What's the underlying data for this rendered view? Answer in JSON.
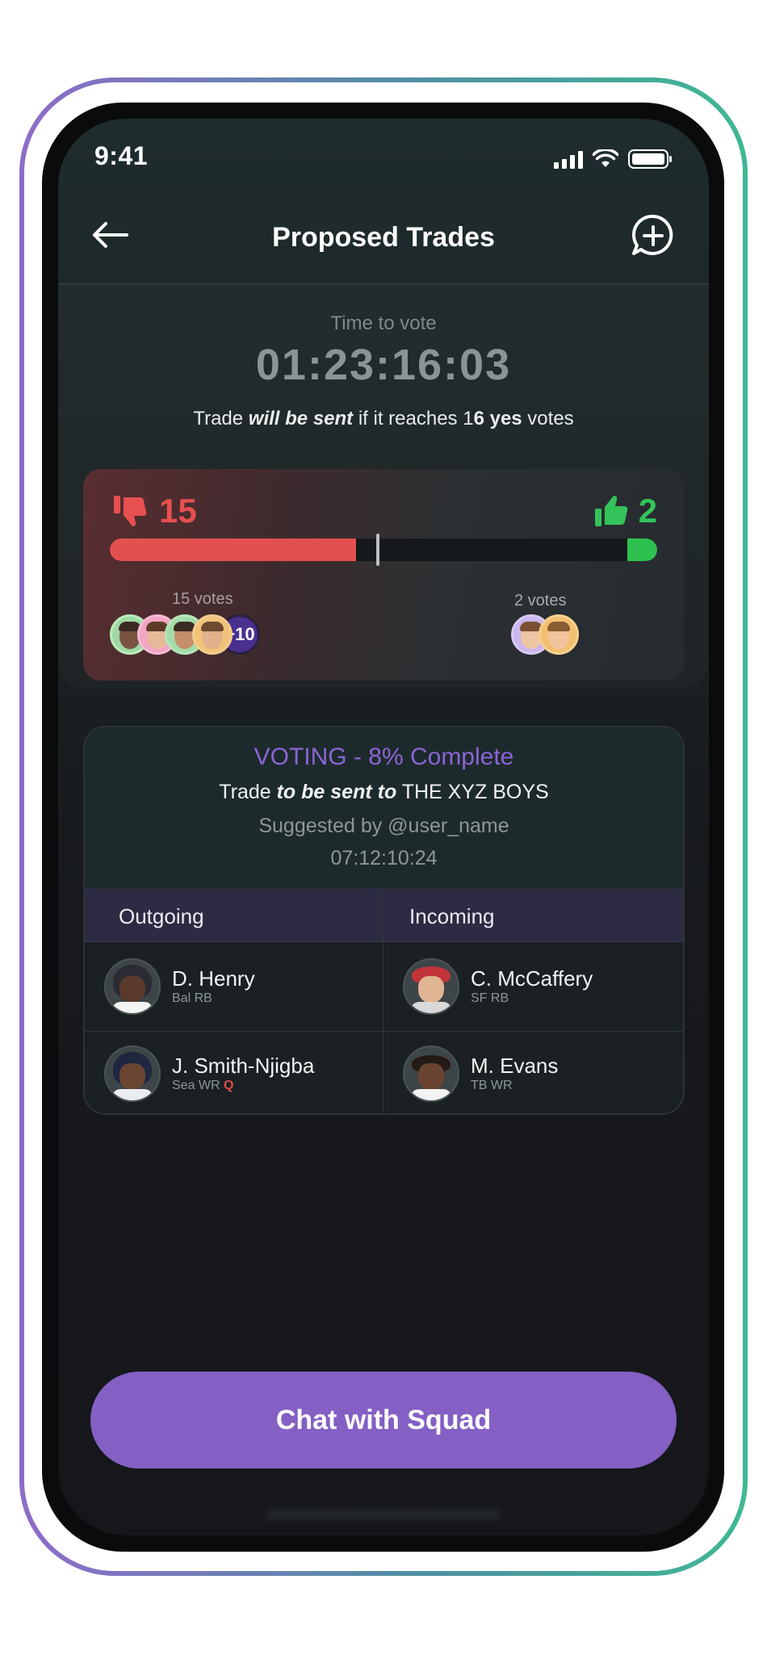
{
  "status_bar": {
    "time": "9:41"
  },
  "header": {
    "title": "Proposed Trades"
  },
  "vote": {
    "time_label": "Time to vote",
    "countdown": "01:23:16:03",
    "threshold_prefix": "Trade ",
    "threshold_emph": "will be sent",
    "threshold_mid": " if it reaches 1",
    "threshold_count_emph": "6 yes",
    "threshold_suffix": " votes",
    "no_count": "15",
    "yes_count": "2",
    "no_votes_label": "15 votes",
    "yes_votes_label": "2 votes",
    "more_avatars": "+10",
    "no_fraction": 0.45,
    "yes_fraction": 0.055
  },
  "trade": {
    "status": "VOTING - 8% Complete",
    "dest_prefix": "Trade ",
    "dest_emph": "to be sent to",
    "dest_team": " THE XYZ BOYS",
    "suggested_by": "Suggested by @user_name",
    "time": "07:12:10:24",
    "outgoing_label": "Outgoing",
    "incoming_label": "Incoming",
    "outgoing": [
      {
        "name": "D. Henry",
        "team": "Bal",
        "pos": "RB",
        "status": ""
      },
      {
        "name": "J. Smith-Njigba",
        "team": "Sea",
        "pos": "WR",
        "status": "Q"
      }
    ],
    "incoming": [
      {
        "name": "C. McCaffery",
        "team": "SF",
        "pos": "RB",
        "status": ""
      },
      {
        "name": "M. Evans",
        "team": "TB",
        "pos": "WR",
        "status": ""
      }
    ]
  },
  "cta": {
    "label": "Chat with Squad"
  },
  "colors": {
    "accent": "#845fc4",
    "no_red": "#e2504f",
    "yes_green": "#2fc14f",
    "voting_purple": "#8b64d6"
  },
  "icons": [
    "back-arrow-icon",
    "add-chat-icon",
    "thumbs-down-icon",
    "thumbs-up-icon",
    "signal-icon",
    "wifi-icon",
    "battery-icon"
  ]
}
